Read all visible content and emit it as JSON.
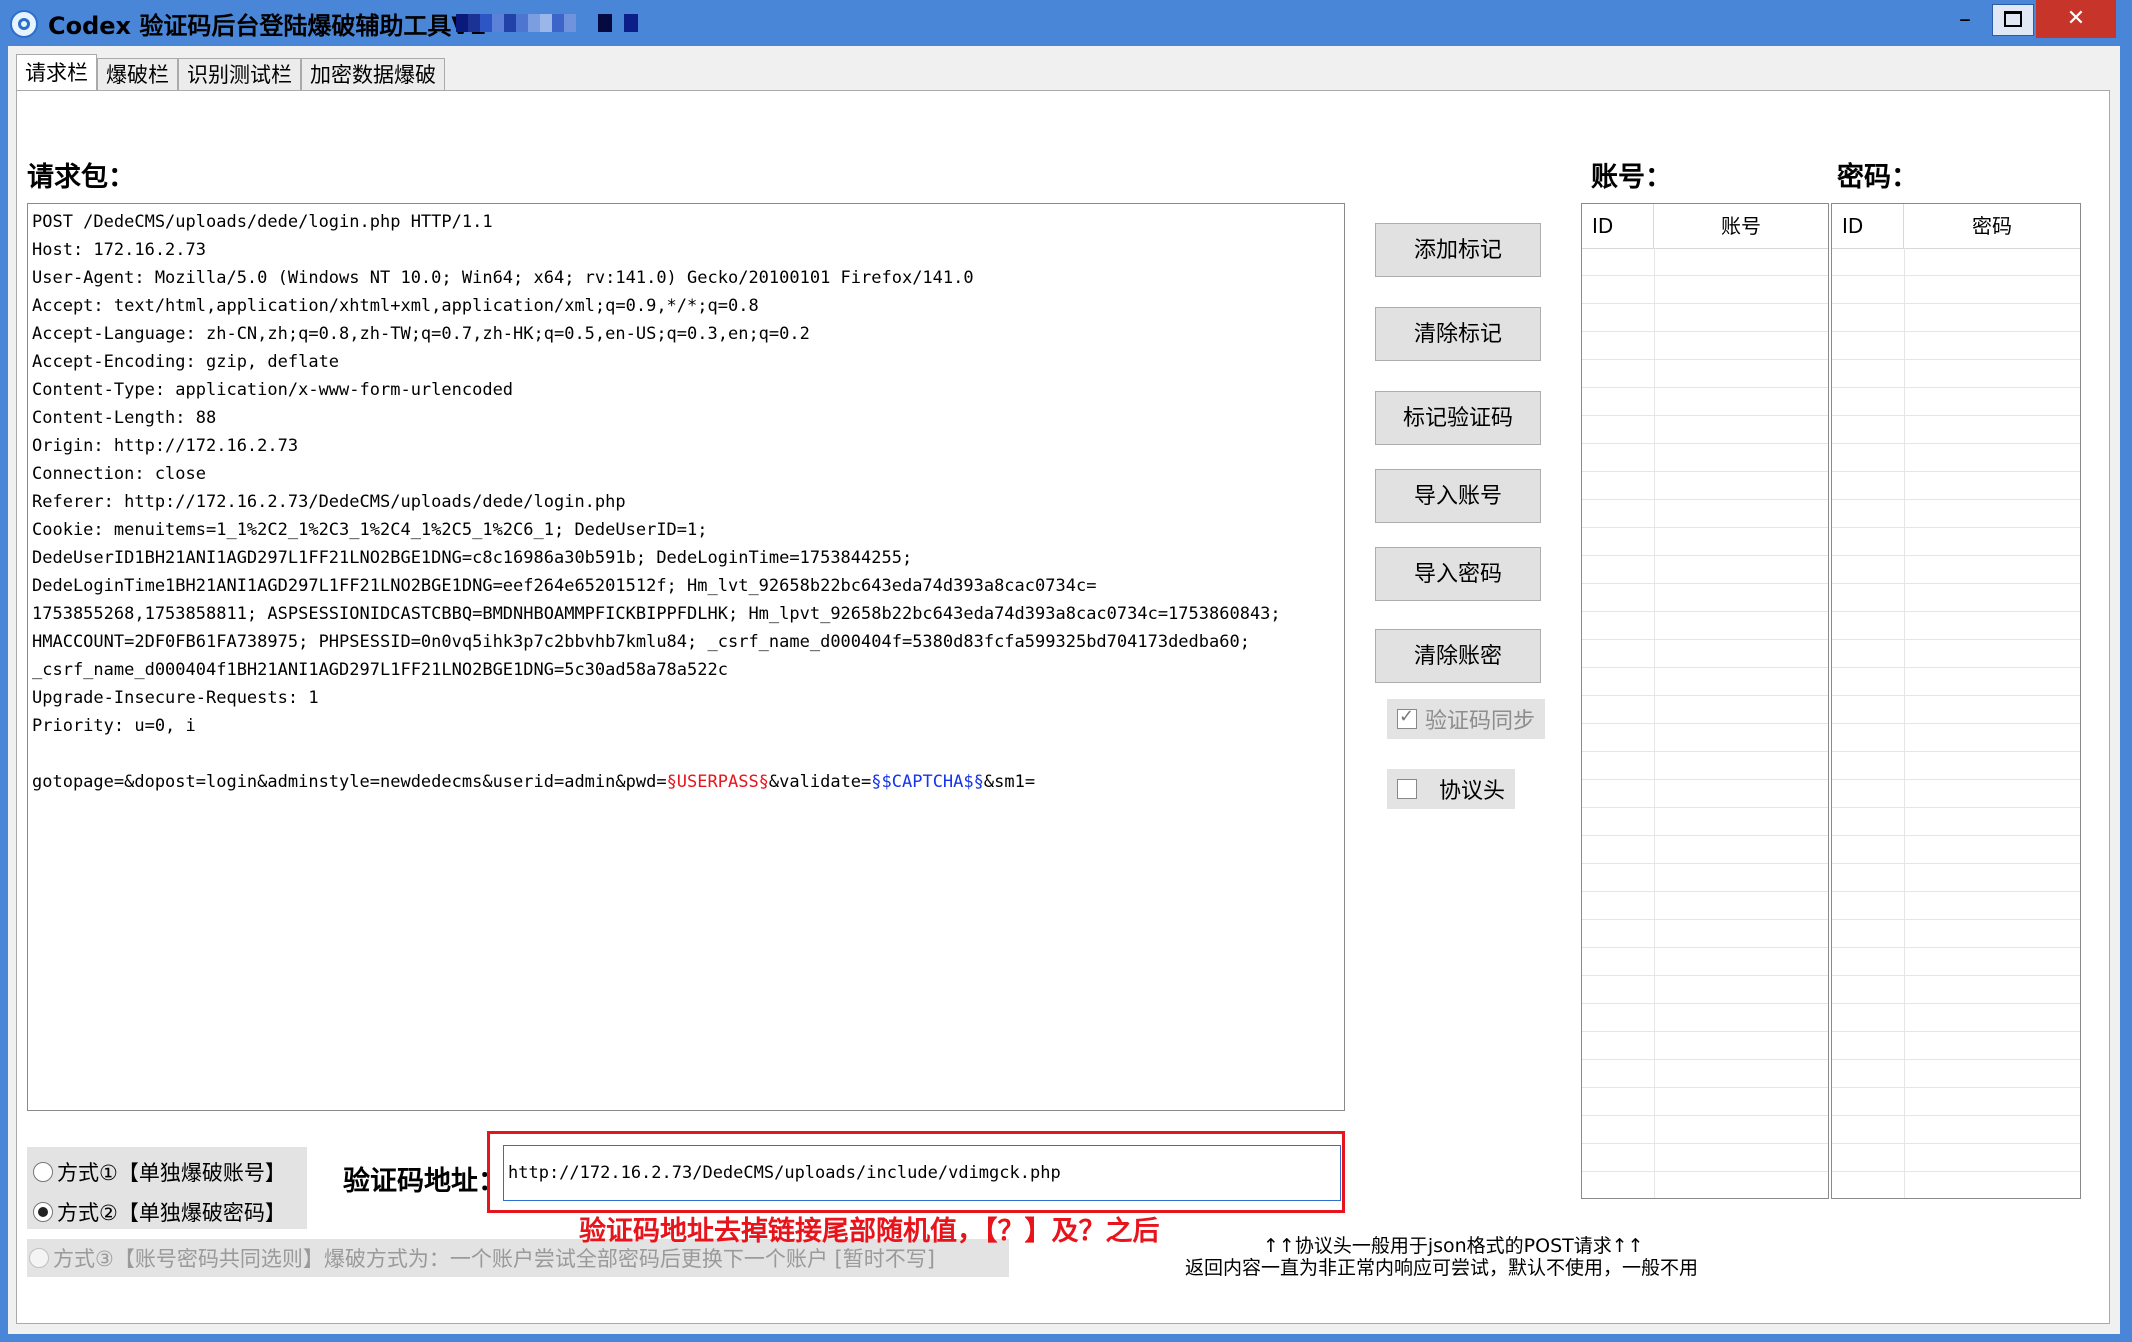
{
  "window": {
    "title": "Codex 验证码后台登陆爆破辅助工具V2",
    "controls": {
      "minimize": "–",
      "close": "✕"
    }
  },
  "tabs": [
    "请求栏",
    "爆破栏",
    "识别测试栏",
    "加密数据爆破"
  ],
  "request": {
    "label": "请求包：",
    "lines": [
      "POST /DedeCMS/uploads/dede/login.php HTTP/1.1",
      "Host: 172.16.2.73",
      "User-Agent: Mozilla/5.0 (Windows NT 10.0; Win64; x64; rv:141.0) Gecko/20100101 Firefox/141.0",
      "Accept: text/html,application/xhtml+xml,application/xml;q=0.9,*/*;q=0.8",
      "Accept-Language: zh-CN,zh;q=0.8,zh-TW;q=0.7,zh-HK;q=0.5,en-US;q=0.3,en;q=0.2",
      "Accept-Encoding: gzip, deflate",
      "Content-Type: application/x-www-form-urlencoded",
      "Content-Length: 88",
      "Origin: http://172.16.2.73",
      "Connection: close",
      "Referer: http://172.16.2.73/DedeCMS/uploads/dede/login.php",
      "Cookie: menuitems=1_1%2C2_1%2C3_1%2C4_1%2C5_1%2C6_1; DedeUserID=1;",
      "DedeUserID1BH21ANI1AGD297L1FF21LNO2BGE1DNG=c8c16986a30b591b; DedeLoginTime=1753844255;",
      "DedeLoginTime1BH21ANI1AGD297L1FF21LNO2BGE1DNG=eef264e65201512f; Hm_lvt_92658b22bc643eda74d393a8cac0734c=",
      "1753855268,1753858811; ASPSESSIONIDCASTCBBQ=BMDNHBOAMMPFICKBIPPFDLHK; Hm_lpvt_92658b22bc643eda74d393a8cac0734c=1753860843;",
      "HMACCOUNT=2DF0FB61FA738975; PHPSESSID=0n0vq5ihk3p7c2bbvhb7kmlu84; _csrf_name_d000404f=5380d83fcfa599325bd704173dedba60;",
      "_csrf_name_d000404f1BH21ANI1AGD297L1FF21LNO2BGE1DNG=5c30ad58a78a522c",
      "Upgrade-Insecure-Requests: 1",
      "Priority: u=0, i",
      ""
    ],
    "body": {
      "part1": "gotopage=&dopost=login&adminstyle=newdedecms&userid=admin&pwd=",
      "marker_user": "§USERPASS§",
      "part2": "&validate=",
      "marker_captcha": "§$CAPTCHA$§",
      "part3": "&sm1="
    }
  },
  "buttons": [
    "添加标记",
    "清除标记",
    "标记验证码",
    "导入账号",
    "导入密码",
    "清除账密"
  ],
  "checkboxes": {
    "captcha_sync": {
      "label": "验证码同步",
      "checked": true,
      "disabled": true
    },
    "protocol_header": {
      "label": "协议头",
      "checked": false
    }
  },
  "accounts": {
    "label": "账号：",
    "col_id": "ID",
    "col_value": "账号"
  },
  "passwords": {
    "label": "密码：",
    "col_id": "ID",
    "col_value": "密码"
  },
  "modes": {
    "mode1": "方式①【单独爆破账号】",
    "mode2": "方式②【单独爆破密码】",
    "mode3": "方式③【账号密码共同选则】爆破方式为：一个账户尝试全部密码后更换下一个账户   [暂时不写]",
    "selected": 2
  },
  "captcha_url": {
    "label": "验证码地址：",
    "value": "http://172.16.2.73/DedeCMS/uploads/include/vdimgck.php"
  },
  "notes": {
    "red_note": "验证码地址去掉链接尾部随机值，【？】及？之后",
    "protocol_note_line1": "↑↑协议头一般用于json格式的POST请求↑↑",
    "protocol_note_line2": "返回内容一直为非正常内响应可尝试，默认不使用，一般不用"
  },
  "colors": {
    "titlebar": "#4a86d8",
    "close": "#c7352a",
    "highlight_red": "#e8141b",
    "marker_blue": "#1535e6"
  }
}
